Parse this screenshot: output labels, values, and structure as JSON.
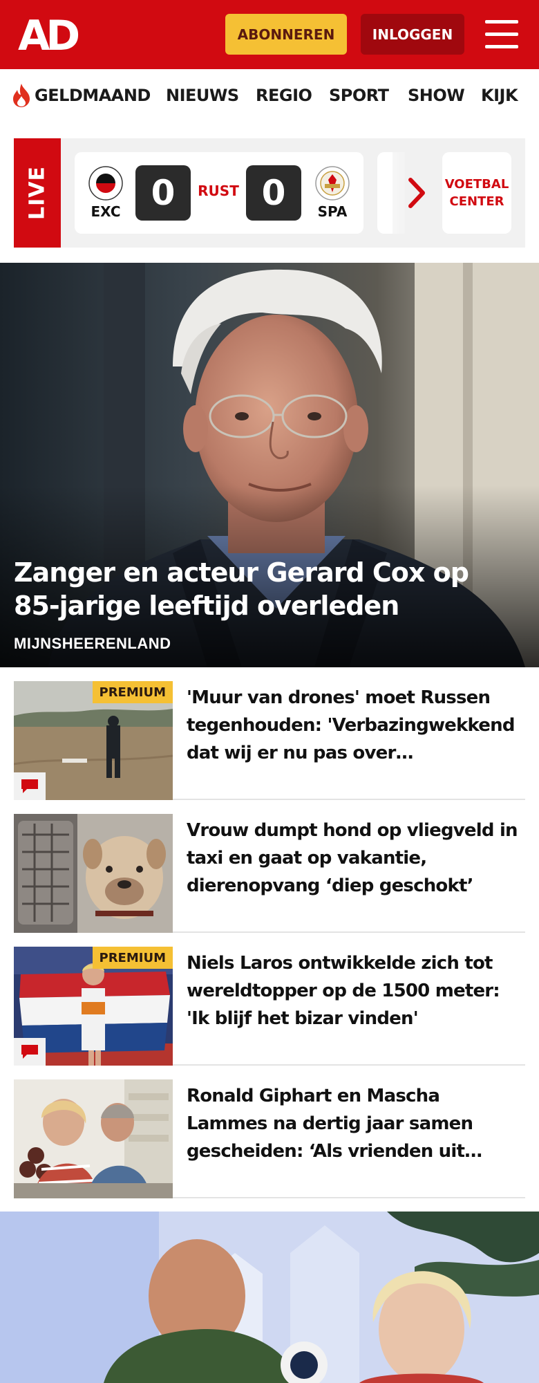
{
  "header": {
    "logo_text": "AD",
    "subscribe_label": "ABONNEREN",
    "login_label": "INLOGGEN",
    "menu_icon": "hamburger-icon",
    "brand_color": "#d10a11",
    "accent_color": "#f5c034"
  },
  "nav": {
    "items": [
      {
        "label": "GELDMAAND",
        "icon": "flame-icon"
      },
      {
        "label": "NIEUWS"
      },
      {
        "label": "REGIO"
      },
      {
        "label": "SPORT"
      },
      {
        "label": "SHOW"
      },
      {
        "label": "KIJK"
      }
    ]
  },
  "live": {
    "tag": "LIVE",
    "match": {
      "home_team": "EXC",
      "home_score": "0",
      "status": "RUST",
      "away_score": "0",
      "away_team": "SPA"
    },
    "next_icon": "chevron-right-icon",
    "center_label_line1": "VOETBAL",
    "center_label_line2": "CENTER"
  },
  "hero": {
    "title": "Zanger en acteur Gerard Cox op 85-jarige leeftijd overleden",
    "kicker": "MIJNSHEERENLAND"
  },
  "articles": [
    {
      "title": "'Muur van drones' moet Russen tegenhouden: 'Verbazingwek­kend dat wij er nu pas over…",
      "premium": "PREMIUM",
      "has_comments": true
    },
    {
      "title": "Vrouw dumpt hond op vliegveld in taxi en gaat op vakantie, dierenopvang ‘diep geschokt’",
      "premium": "",
      "has_comments": false
    },
    {
      "title": "Niels Laros ontwikkelde zich tot wereldtopper op de 1500 meter: 'Ik blijf het bizar vinden'",
      "premium": "PREMIUM",
      "has_comments": true
    },
    {
      "title": "Ronald Giphart en Mascha Lammes na dertig jaar samen gescheiden: ‘Als vrienden uit…",
      "premium": "",
      "has_comments": false
    }
  ]
}
